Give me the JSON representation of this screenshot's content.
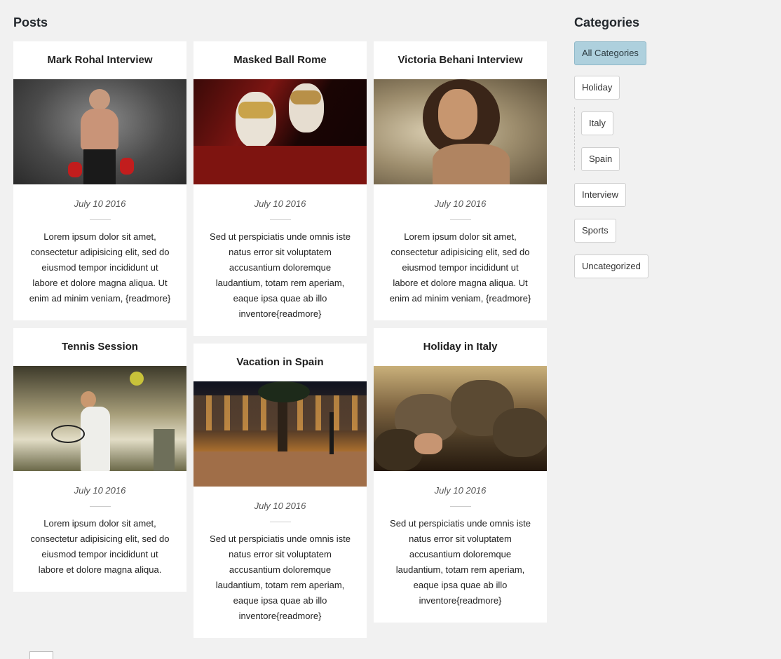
{
  "posts_heading": "Posts",
  "categories_heading": "Categories",
  "posts": [
    {
      "title": "Mark Rohal Interview",
      "image": "boxer-photo",
      "date": "July 10 2016",
      "excerpt": "Lorem ipsum dolor sit amet, consectetur adipisicing elit, sed do eiusmod tempor incididunt ut labore et dolore magna aliqua. Ut enim ad minim veniam, {readmore}"
    },
    {
      "title": "Masked Ball Rome",
      "image": "venetian-masks-photo",
      "date": "July 10 2016",
      "excerpt": "Sed ut perspiciatis unde omnis iste natus error sit voluptatem accusantium doloremque laudantium, totam rem aperiam, eaque ipsa quae ab illo inventore{readmore}"
    },
    {
      "title": "Victoria Behani Interview",
      "image": "woman-portrait-photo",
      "date": "July 10 2016",
      "excerpt": "Lorem ipsum dolor sit amet, consectetur adipisicing elit, sed do eiusmod tempor incididunt ut labore et dolore magna aliqua. Ut enim ad minim veniam, {readmore}"
    },
    {
      "title": "Tennis Session",
      "image": "tennis-player-photo",
      "date": "July 10 2016",
      "excerpt": "Lorem ipsum dolor sit amet, consectetur adipisicing elit, sed do eiusmod tempor incididunt ut labore et dolore magna aliqua."
    },
    {
      "title": "Vacation in Spain",
      "image": "spanish-plaza-photo",
      "date": "July 10 2016",
      "excerpt": "Sed ut perspiciatis unde omnis iste natus error sit voluptatem accusantium doloremque laudantium, totam rem aperiam, eaque ipsa quae ab illo inventore{readmore}"
    },
    {
      "title": "Holiday in Italy",
      "image": "rocks-beach-photo",
      "date": "July 10 2016",
      "excerpt": "Sed ut perspiciatis unde omnis iste natus error sit voluptatem accusantium doloremque laudantium, totam rem aperiam, eaque ipsa quae ab illo inventore{readmore}"
    }
  ],
  "categories": [
    {
      "label": "All Categories",
      "active": true
    },
    {
      "label": "Holiday"
    },
    {
      "label": "Italy"
    },
    {
      "label": "Spain"
    },
    {
      "label": "Interview"
    },
    {
      "label": "Sports"
    },
    {
      "label": "Uncategorized"
    }
  ],
  "colors": {
    "active_category": "#aed0dd",
    "background": "#f1f1f1"
  }
}
